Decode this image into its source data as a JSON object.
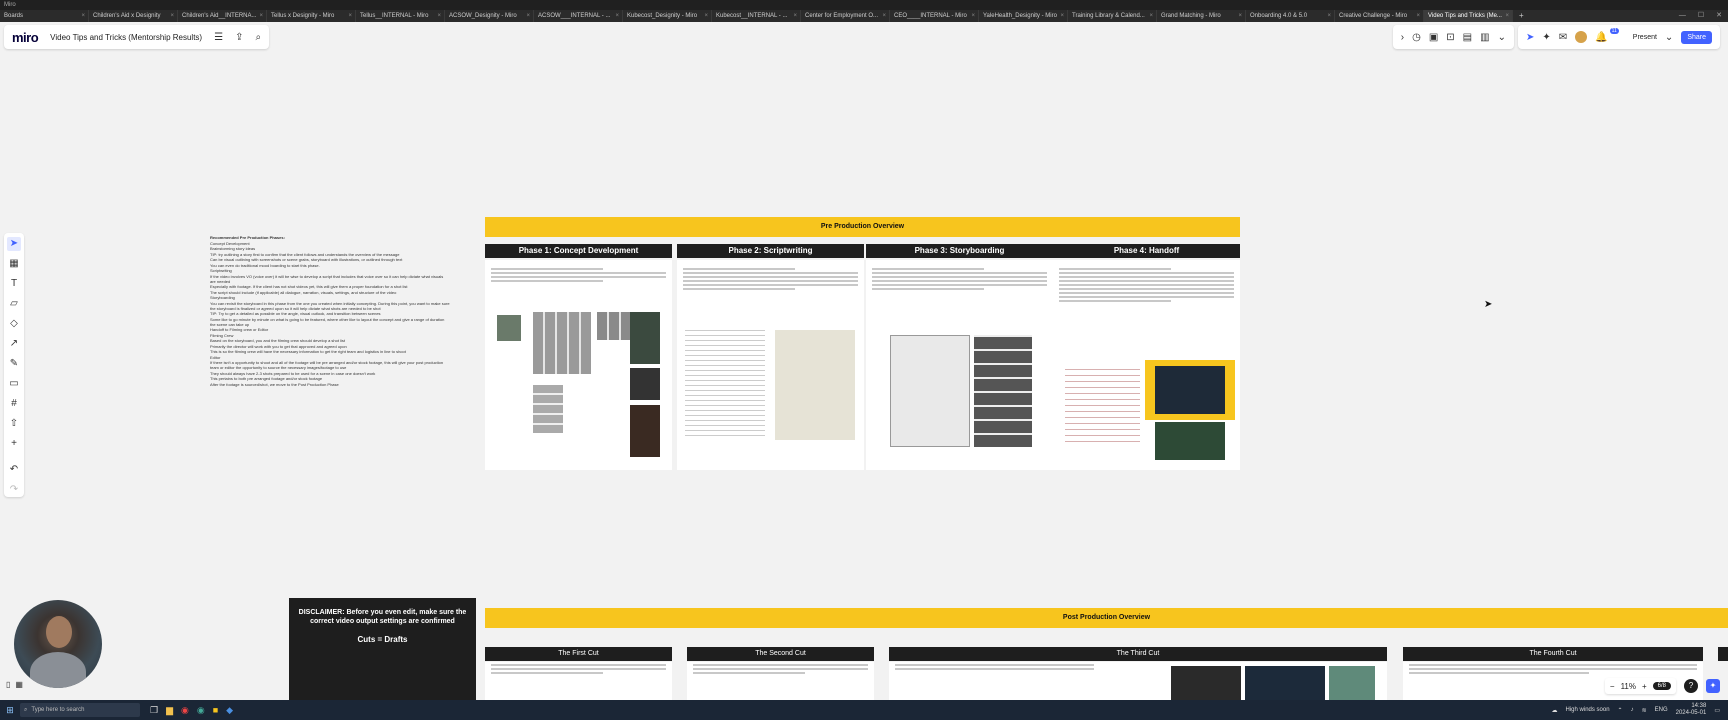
{
  "window": {
    "title": "Miro"
  },
  "browser_tabs": [
    {
      "label": "Boards",
      "active": false
    },
    {
      "label": "Children's Aid x Designity",
      "active": false
    },
    {
      "label": "Children's Aid__INTERNA...",
      "active": false
    },
    {
      "label": "Tellus x Designity - Miro",
      "active": false
    },
    {
      "label": "Tellus__INTERNAL - Miro",
      "active": false
    },
    {
      "label": "ACSOW_Designity - Miro",
      "active": false
    },
    {
      "label": "ACSOW___INTERNAL - ...",
      "active": false
    },
    {
      "label": "Kubecost_Designity - Miro",
      "active": false
    },
    {
      "label": "Kubecost__INTERNAL - ...",
      "active": false
    },
    {
      "label": "Center for Employment O...",
      "active": false
    },
    {
      "label": "CEO____INTERNAL - Miro",
      "active": false
    },
    {
      "label": "YaleHealth_Designity - Miro",
      "active": false
    },
    {
      "label": "Training Library & Calend...",
      "active": false
    },
    {
      "label": "Grand Matching - Miro",
      "active": false
    },
    {
      "label": "Onboarding 4.0 & 5.0",
      "active": false
    },
    {
      "label": "Creative Challenge - Miro",
      "active": false
    },
    {
      "label": "Video Tips and Tricks (Me...",
      "active": true
    }
  ],
  "app": {
    "logo": "miro",
    "board_title": "Video Tips and Tricks (Mentorship Results)",
    "menu_icon": "menu-icon",
    "export_icon": "export-icon",
    "search_icon": "search-icon",
    "present_label": "Present",
    "share_label": "Share",
    "accent_color": "#4262ff",
    "notification_count": "11"
  },
  "notes": {
    "title": "Recommended Pre Production Phases:",
    "lines": [
      "Concept Development",
      "Brainstorming story ideas",
      "TIP: try outlining a story first to confirm that the client follows and understands the overview of the message",
      "Can be visual outlining with screenshots or scene grabs, storyboard with illustrations, or outlined through text",
      "You can even do traditional mood boarding to start this phase.",
      "Scriptwriting",
      "If the video involves VO (voice over) it will be wise to develop a script that includes that voice over so it can help dictate what visuals are needed",
      "Especially with footage. If the client has not shot videos yet, this will give them a proper foundation for a shot list",
      "The script should include (if applicable) all dialogue, narration, visuals, settings, and structure of the video",
      "Storyboarding",
      "You can revisit the storyboard in this phase from the one you created when initially concepting. During this point, you want to make sure the storyboard is finalized or agreed upon so it will help dictate what shots are needed to be shot",
      "TIP: Try to get a detailed as possible on the angle, visual outlook, and transition between scenes",
      "Some like to go minute by minute on what is going to be featured, where other like to layout the concept and give a range of duration the scene can take up",
      "Handoff to Filming crew or Editor",
      "Filming Crew",
      "Based on the storyboard, you and the filming crew should develop a shot list",
      "Primarily the director will work with you to get that approved and agreed upon",
      "This is so the filming crew will have the necessary information to get the right team and logistics in line to shoot",
      "Editor",
      "If there isn't a opportunity to shoot and all of the footage will be pre arranged and/or stock footage, this will give your post production team or editor the opportunity to source the necessary images/footage to use",
      "They should always have 2-3 shots prepared to be used for a scene in case one doesn't work",
      "This pertains to both pre arranged footage and/or stock footage",
      "After the footage is sourced/shot, we move to the Post Production Phase"
    ]
  },
  "pre_production": {
    "banner": "Pre Production Overview",
    "phases": [
      {
        "title": "Phase 1: Concept Development"
      },
      {
        "title": "Phase 2: Scriptwriting"
      },
      {
        "title": "Phase 3: Storyboarding"
      },
      {
        "title": "Phase 4: Handoff"
      }
    ]
  },
  "post_production": {
    "banner": "Post Production Overview",
    "cuts": [
      {
        "title": "The First Cut"
      },
      {
        "title": "The Second Cut"
      },
      {
        "title": "The Third Cut"
      },
      {
        "title": "The Fourth Cut"
      }
    ]
  },
  "disclaimer": {
    "text": "DISCLAIMER: Before you even edit, make sure the correct video output settings are confirmed",
    "cuts_label": "Cuts = Drafts"
  },
  "bottom_right": {
    "zoom": "11%",
    "zoom_out_icon": "minus-icon",
    "zoom_in_icon": "plus-icon",
    "page_count": "6/8",
    "help_label": "?"
  },
  "taskbar": {
    "search_placeholder": "Type here to search",
    "weather": "High winds soon",
    "language": "ENG",
    "time": "14:38",
    "date": "2024-05-01"
  }
}
